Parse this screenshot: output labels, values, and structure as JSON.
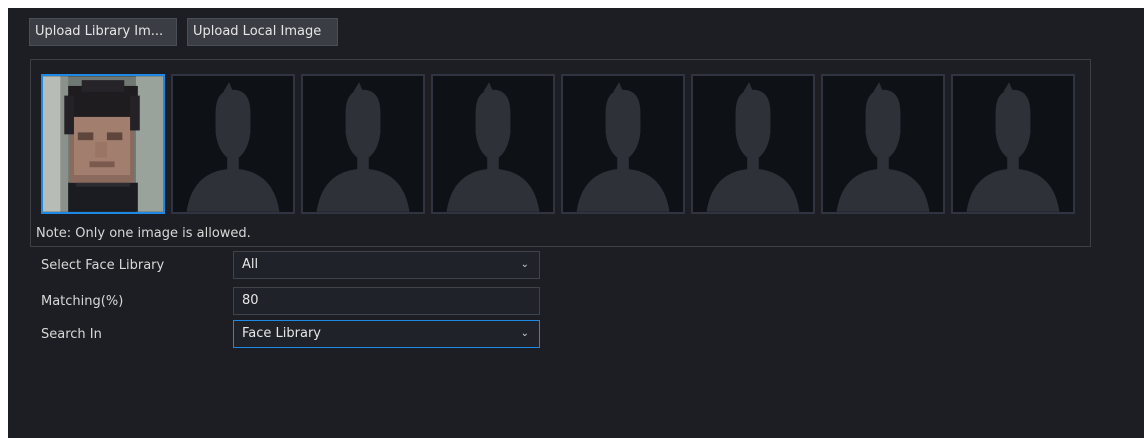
{
  "toolbar": {
    "upload_library_label": "Upload Library Im...",
    "upload_local_label": "Upload Local Image"
  },
  "gallery": {
    "note": "Note: Only one image is allowed.",
    "slots": [
      {
        "type": "face-photo",
        "selected": true
      },
      {
        "type": "placeholder",
        "selected": false
      },
      {
        "type": "placeholder",
        "selected": false
      },
      {
        "type": "placeholder",
        "selected": false
      },
      {
        "type": "placeholder",
        "selected": false
      },
      {
        "type": "placeholder",
        "selected": false
      },
      {
        "type": "placeholder",
        "selected": false
      },
      {
        "type": "placeholder",
        "selected": false
      }
    ]
  },
  "form": {
    "face_library": {
      "label": "Select Face Library",
      "value": "All"
    },
    "matching": {
      "label": "Matching(%)",
      "value": "80"
    },
    "search_in": {
      "label": "Search In",
      "value": "Face Library"
    }
  },
  "colors": {
    "background": "#1c1e23",
    "accent": "#1e88e5",
    "text": "#d8d8d8"
  }
}
